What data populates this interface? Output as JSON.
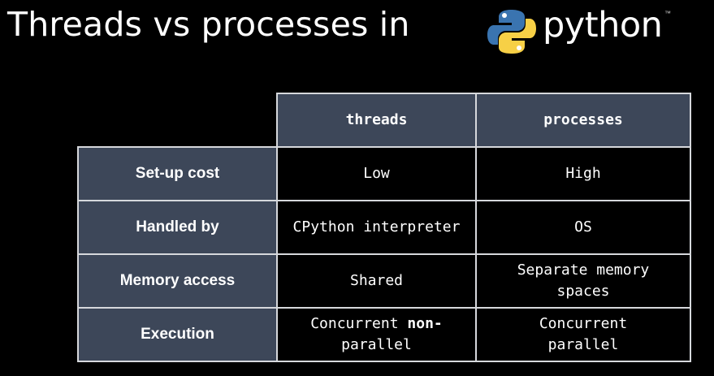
{
  "title": "Threads vs processes in",
  "logo": {
    "word": "python",
    "tm": "™",
    "colors": {
      "blue": "#3a74b0",
      "yellow": "#f7d046"
    }
  },
  "table": {
    "columns": [
      "threads",
      "processes"
    ],
    "rows": [
      {
        "label": "Set-up cost",
        "threads": "Low",
        "processes": "High"
      },
      {
        "label": "Handled by",
        "threads": "CPython interpreter",
        "processes": "OS"
      },
      {
        "label": "Memory access",
        "threads": "Shared",
        "processes": "Separate memory\nspaces"
      },
      {
        "label": "Execution",
        "threads_prefix": "Concurrent ",
        "threads_emph": "non-",
        "threads_suffix": "\nparallel",
        "processes": "Concurrent\nparallel"
      }
    ]
  }
}
